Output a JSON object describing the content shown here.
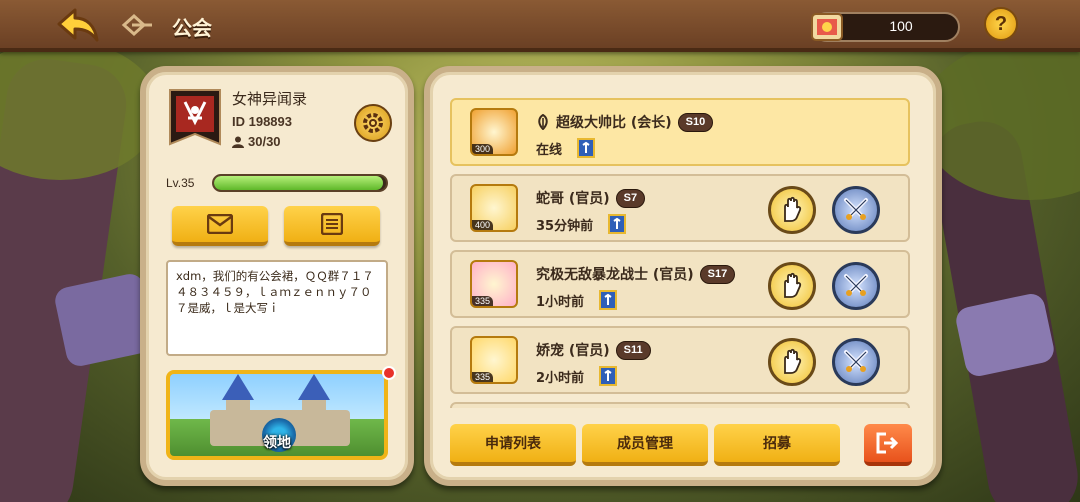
{
  "header": {
    "title": "公会",
    "currency_value": "100",
    "help_label": "?"
  },
  "guild": {
    "name": "女神异闻录",
    "id": "ID 198893",
    "members": "30/30",
    "level": "Lv.35",
    "level_progress": 0.98,
    "notice": "xdm，我们的有公会裙，ＱＱ群７１７４８３４５９，ｌａｍｚｅｎｎｙ７０７是威，ｌ是大写ｉ",
    "territory_label": "领地"
  },
  "members": [
    {
      "name": "超级大帅比 (会长)",
      "server": "S10",
      "status": "在线",
      "avatar_level": "300",
      "leader": true
    },
    {
      "name": "蛇哥 (官员)",
      "server": "S7",
      "status": "35分钟前",
      "avatar_level": "400",
      "leader": false
    },
    {
      "name": "究极无敌暴龙战士 (官员)",
      "server": "S17",
      "status": "1小时前",
      "avatar_level": "335",
      "leader": false
    },
    {
      "name": "娇宠 (官员)",
      "server": "S11",
      "status": "2小时前",
      "avatar_level": "335",
      "leader": false
    }
  ],
  "actions": {
    "apply_list": "申请列表",
    "member_manage": "成员管理",
    "recruit": "招募"
  },
  "colors": {
    "accent_yellow": "#f0b014",
    "panel_bg": "#f6ead0",
    "exit_orange": "#e8521c",
    "level_green": "#5fb82a"
  }
}
